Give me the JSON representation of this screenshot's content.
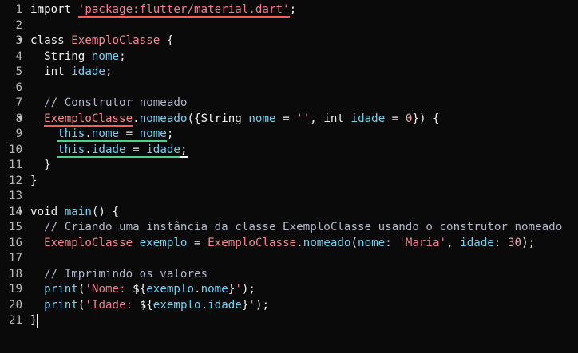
{
  "editor": {
    "language": "dart",
    "lines": [
      {
        "n": "1",
        "tokens": [
          {
            "t": "import",
            "c": "t-kw"
          },
          {
            "t": " ",
            "c": "t-pl"
          },
          {
            "t": "'package:flutter/material.dart'",
            "c": "t-str u-red"
          },
          {
            "t": ";",
            "c": "t-pl"
          }
        ]
      },
      {
        "n": "2",
        "tokens": []
      },
      {
        "n": "3",
        "fold": "▼",
        "tokens": [
          {
            "t": "class",
            "c": "t-kw"
          },
          {
            "t": " ",
            "c": "t-pl"
          },
          {
            "t": "ExemploClasse",
            "c": "t-cls"
          },
          {
            "t": " {",
            "c": "t-pl"
          }
        ]
      },
      {
        "n": "4",
        "tokens": [
          {
            "t": "  String",
            "c": "t-type"
          },
          {
            "t": " ",
            "c": "t-pl"
          },
          {
            "t": "nome",
            "c": "t-id"
          },
          {
            "t": ";",
            "c": "t-pl"
          }
        ]
      },
      {
        "n": "5",
        "tokens": [
          {
            "t": "  int",
            "c": "t-type"
          },
          {
            "t": " ",
            "c": "t-pl"
          },
          {
            "t": "idade",
            "c": "t-id"
          },
          {
            "t": ";",
            "c": "t-pl"
          }
        ]
      },
      {
        "n": "6",
        "tokens": []
      },
      {
        "n": "7",
        "tokens": [
          {
            "t": "  // Construtor nomeado",
            "c": "t-cm"
          }
        ]
      },
      {
        "n": "8",
        "fold": "▼",
        "tokens": [
          {
            "t": "  ",
            "c": "t-pl"
          },
          {
            "t": "ExemploClasse",
            "c": "t-cls u-red"
          },
          {
            "t": ".",
            "c": "t-pl"
          },
          {
            "t": "nomeado",
            "c": "t-fn"
          },
          {
            "t": "({",
            "c": "t-pl"
          },
          {
            "t": "String",
            "c": "t-type"
          },
          {
            "t": " ",
            "c": "t-pl"
          },
          {
            "t": "nome",
            "c": "t-id"
          },
          {
            "t": " = ",
            "c": "t-pl"
          },
          {
            "t": "''",
            "c": "t-str"
          },
          {
            "t": ", ",
            "c": "t-pl"
          },
          {
            "t": "int",
            "c": "t-type"
          },
          {
            "t": " ",
            "c": "t-pl"
          },
          {
            "t": "idade",
            "c": "t-id"
          },
          {
            "t": " = ",
            "c": "t-pl"
          },
          {
            "t": "0",
            "c": "t-num"
          },
          {
            "t": "}) {",
            "c": "t-pl"
          }
        ]
      },
      {
        "n": "9",
        "tokens": [
          {
            "t": "    ",
            "c": "t-pl"
          },
          {
            "t": "this",
            "c": "t-id u-grn"
          },
          {
            "t": ".",
            "c": "t-pl u-grn"
          },
          {
            "t": "nome",
            "c": "t-id u-grn"
          },
          {
            "t": " = ",
            "c": "t-pl u-grn"
          },
          {
            "t": "nome",
            "c": "t-id u-grn"
          },
          {
            "t": ";",
            "c": "t-pl"
          }
        ]
      },
      {
        "n": "10",
        "tokens": [
          {
            "t": "    ",
            "c": "t-pl"
          },
          {
            "t": "this",
            "c": "t-id u-grn"
          },
          {
            "t": ".",
            "c": "t-pl u-grn"
          },
          {
            "t": "idade",
            "c": "t-id u-grn"
          },
          {
            "t": " = ",
            "c": "t-pl u-grn"
          },
          {
            "t": "idade",
            "c": "t-id u-grn"
          },
          {
            "t": ";",
            "c": "t-pl u-wht"
          }
        ]
      },
      {
        "n": "11",
        "tokens": [
          {
            "t": "  }",
            "c": "t-pl"
          }
        ]
      },
      {
        "n": "12",
        "tokens": [
          {
            "t": "}",
            "c": "t-pl"
          }
        ]
      },
      {
        "n": "13",
        "tokens": []
      },
      {
        "n": "14",
        "fold": "▼",
        "tokens": [
          {
            "t": "void",
            "c": "t-kw"
          },
          {
            "t": " ",
            "c": "t-pl"
          },
          {
            "t": "main",
            "c": "t-fn"
          },
          {
            "t": "() {",
            "c": "t-pl"
          }
        ]
      },
      {
        "n": "15",
        "tokens": [
          {
            "t": "  // Criando uma instância da classe ExemploClasse usando o construtor nomeado",
            "c": "t-cm"
          }
        ]
      },
      {
        "n": "16",
        "tokens": [
          {
            "t": "  ",
            "c": "t-pl"
          },
          {
            "t": "ExemploClasse",
            "c": "t-cls"
          },
          {
            "t": " ",
            "c": "t-pl"
          },
          {
            "t": "exemplo",
            "c": "t-id"
          },
          {
            "t": " = ",
            "c": "t-pl"
          },
          {
            "t": "ExemploClasse",
            "c": "t-cls"
          },
          {
            "t": ".",
            "c": "t-pl"
          },
          {
            "t": "nomeado",
            "c": "t-fn"
          },
          {
            "t": "(",
            "c": "t-pl"
          },
          {
            "t": "nome",
            "c": "t-id"
          },
          {
            "t": ": ",
            "c": "t-pl"
          },
          {
            "t": "'Maria'",
            "c": "t-str"
          },
          {
            "t": ", ",
            "c": "t-pl"
          },
          {
            "t": "idade",
            "c": "t-id"
          },
          {
            "t": ": ",
            "c": "t-pl"
          },
          {
            "t": "30",
            "c": "t-num"
          },
          {
            "t": ");",
            "c": "t-pl"
          }
        ]
      },
      {
        "n": "17",
        "tokens": []
      },
      {
        "n": "18",
        "tokens": [
          {
            "t": "  // Imprimindo os valores",
            "c": "t-cm"
          }
        ]
      },
      {
        "n": "19",
        "tokens": [
          {
            "t": "  ",
            "c": "t-pl"
          },
          {
            "t": "print",
            "c": "t-fn"
          },
          {
            "t": "(",
            "c": "t-pl"
          },
          {
            "t": "'Nome: ",
            "c": "t-str"
          },
          {
            "t": "${",
            "c": "t-pl"
          },
          {
            "t": "exemplo",
            "c": "t-id"
          },
          {
            "t": ".",
            "c": "t-pl"
          },
          {
            "t": "nome",
            "c": "t-id"
          },
          {
            "t": "}",
            "c": "t-pl"
          },
          {
            "t": "'",
            "c": "t-str"
          },
          {
            "t": ");",
            "c": "t-pl"
          }
        ]
      },
      {
        "n": "20",
        "tokens": [
          {
            "t": "  ",
            "c": "t-pl"
          },
          {
            "t": "print",
            "c": "t-fn"
          },
          {
            "t": "(",
            "c": "t-pl"
          },
          {
            "t": "'Idade: ",
            "c": "t-str"
          },
          {
            "t": "${",
            "c": "t-pl"
          },
          {
            "t": "exemplo",
            "c": "t-id"
          },
          {
            "t": ".",
            "c": "t-pl"
          },
          {
            "t": "idade",
            "c": "t-id"
          },
          {
            "t": "}",
            "c": "t-pl"
          },
          {
            "t": "'",
            "c": "t-str"
          },
          {
            "t": ");",
            "c": "t-pl"
          }
        ]
      },
      {
        "n": "21",
        "tokens": [
          {
            "t": "}",
            "c": "t-pl"
          }
        ]
      }
    ]
  }
}
